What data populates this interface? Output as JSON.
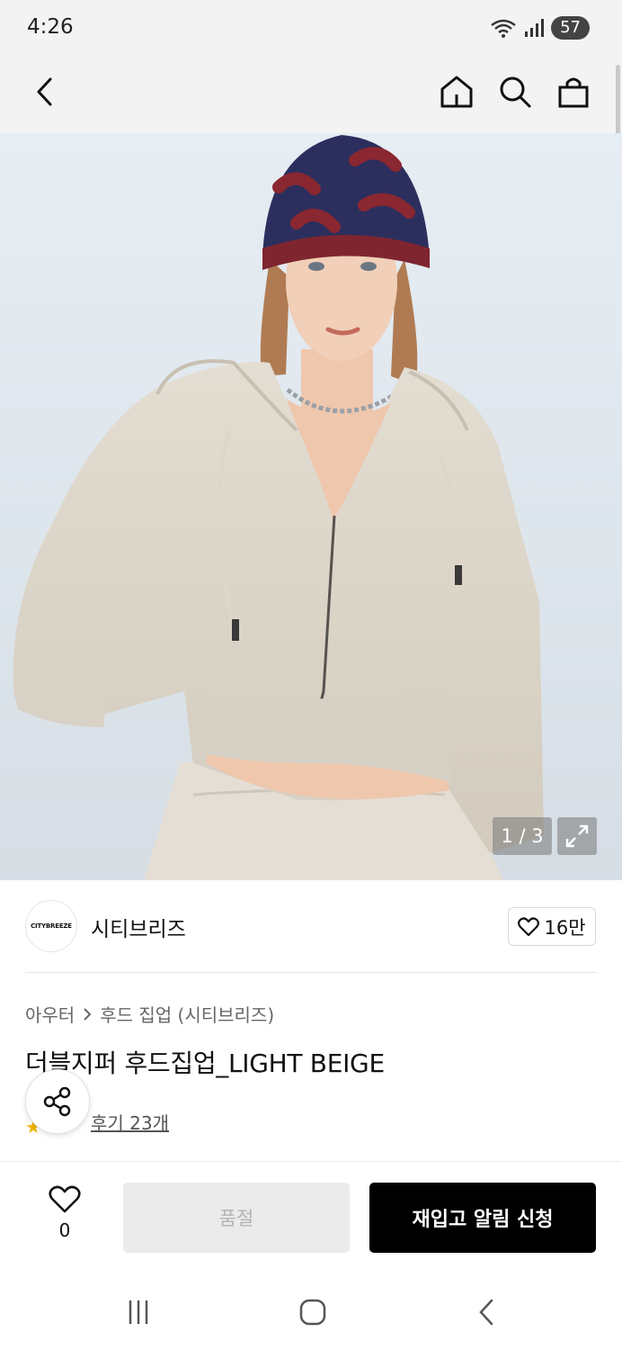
{
  "status_bar": {
    "time": "4:26",
    "battery": "57"
  },
  "header": {
    "back_icon": "chevron-left-icon",
    "home_icon": "home-icon",
    "search_icon": "search-icon",
    "bag_icon": "shopping-bag-icon"
  },
  "gallery": {
    "counter": "1 / 3",
    "expand_icon": "expand-icon"
  },
  "brand": {
    "logo_text": "CITYBREEZE",
    "name": "시티브리즈",
    "like_count": "16만"
  },
  "breadcrumb": {
    "category": "아우터",
    "subcategory": "후드 집업 (시티브리즈)"
  },
  "product": {
    "title": "더블지퍼 후드집업_LIGHT BEIGE",
    "review_label": "후기 23개"
  },
  "bottom_bar": {
    "wish_count": "0",
    "soldout_label": "품절",
    "restock_label": "재입고 알림 신청"
  },
  "colors": {
    "accent": "#000000",
    "disabled_bg": "#ebebeb",
    "star": "#f0b400"
  }
}
